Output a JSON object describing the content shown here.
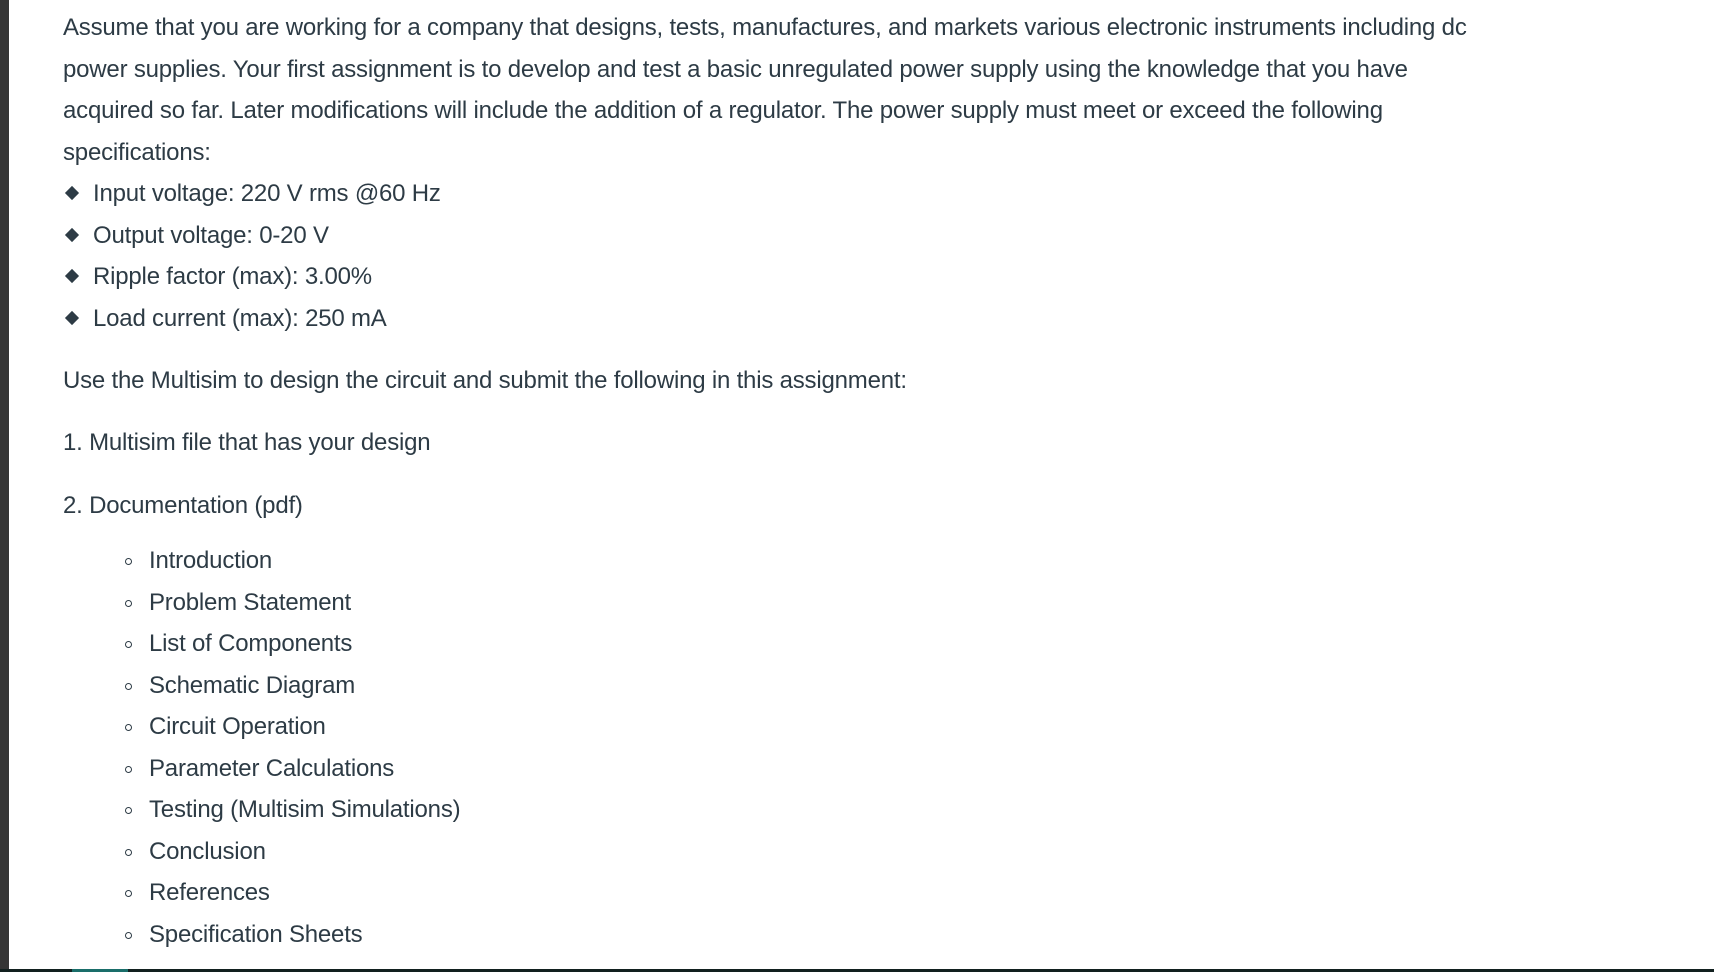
{
  "document": {
    "intro_paragraph": "Assume that you are working for a company that designs, tests, manufactures, and markets various electronic instruments including dc power supplies. Your first assignment is to develop and test a basic unregulated power supply using the knowledge that you have acquired so far. Later modifications will include the addition of a regulator. The power supply must meet or exceed the following specifications:",
    "intro_lines": [
      "Assume that you are working for a company that designs, tests, manufactures, and markets various electronic instruments including dc",
      "power supplies. Your first assignment is to develop and test a basic unregulated power supply using the knowledge that you have",
      "acquired so far. Later modifications will include the addition of a regulator. The power supply must meet or exceed the following",
      "specifications:"
    ],
    "specifications": [
      {
        "label": "Input voltage: 220 V rms @60 Hz"
      },
      {
        "label": "Output voltage: 0-20 V"
      },
      {
        "label": "Ripple factor (max): 3.00%"
      },
      {
        "label": "Load current (max): 250 mA"
      }
    ],
    "instruction": "Use the Multisim to design the circuit and submit the following in this assignment:",
    "deliverables": [
      {
        "label": "1. Multisim file that has your design"
      },
      {
        "label": "2. Documentation (pdf)"
      }
    ],
    "documentation_sections": [
      {
        "label": "Introduction"
      },
      {
        "label": "Problem Statement"
      },
      {
        "label": "List of Components"
      },
      {
        "label": "Schematic Diagram"
      },
      {
        "label": "Circuit Operation"
      },
      {
        "label": "Parameter Calculations"
      },
      {
        "label": "Testing (Multisim Simulations)"
      },
      {
        "label": "Conclusion"
      },
      {
        "label": "References"
      },
      {
        "label": "Specification Sheets"
      }
    ]
  },
  "colors": {
    "text": "#2d3b45",
    "left_bar": "#353535",
    "bottom_bar": "#12201f",
    "bottom_accent": "#1a6e6a"
  }
}
